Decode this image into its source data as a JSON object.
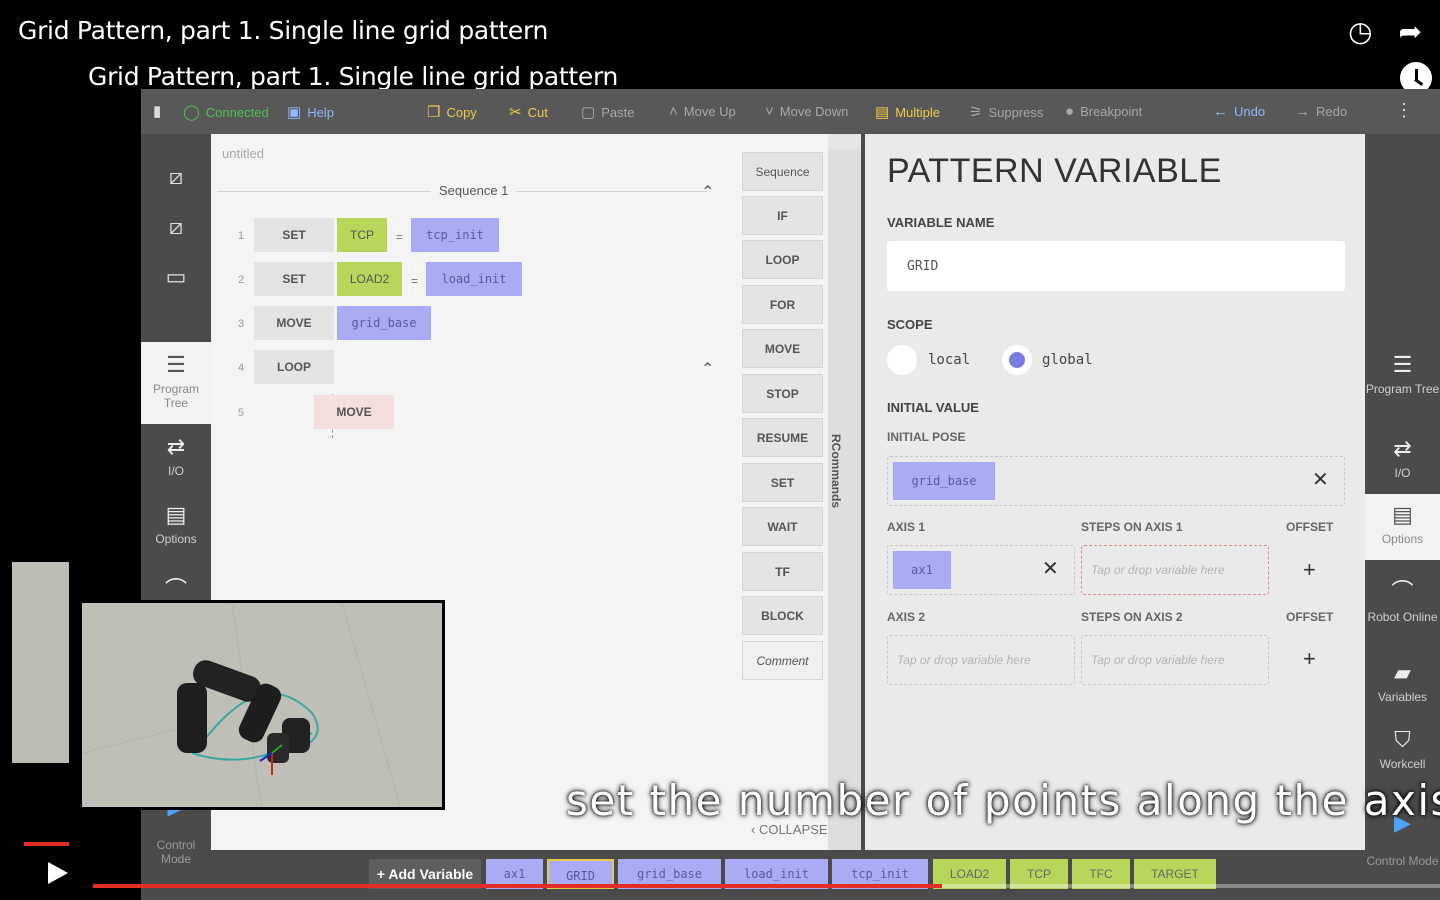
{
  "youtube": {
    "top_title": "Grid Pattern, part 1. Single line grid pattern",
    "video_title": "Grid Pattern, part 1. Single line grid pattern",
    "watch_later_icon": "clock-icon",
    "share_icon": "share-arrow-icon",
    "caption": "set the number of points along the axis",
    "progress_fraction": 0.63
  },
  "toolbar": {
    "connected": "Connected",
    "help": "Help",
    "copy": "Copy",
    "cut": "Cut",
    "paste": "Paste",
    "move_up": "Move Up",
    "move_down": "Move Down",
    "multiple": "Multiple",
    "suppress": "Suppress",
    "breakpoint": "Breakpoint",
    "undo": "Undo",
    "redo": "Redo"
  },
  "left_rail": {
    "program_tree": "Program Tree",
    "io": "I/O",
    "options": "Options",
    "control_mode": "Control Mode"
  },
  "tree": {
    "file_name": "untitled",
    "sequence_label": "Sequence 1",
    "rows": [
      {
        "num": "1",
        "cmd": "SET",
        "a": "TCP",
        "eq": "=",
        "b": "tcp_init"
      },
      {
        "num": "2",
        "cmd": "SET",
        "a": "LOAD2",
        "eq": "=",
        "b": "load_init"
      },
      {
        "num": "3",
        "cmd": "MOVE",
        "b": "grid_base"
      },
      {
        "num": "4",
        "cmd": "LOOP"
      },
      {
        "num": "5",
        "cmd": "MOVE"
      }
    ]
  },
  "commands": [
    "Sequence",
    "IF",
    "LOOP",
    "FOR",
    "MOVE",
    "STOP",
    "RESUME",
    "SET",
    "WAIT",
    "TF",
    "BLOCK",
    "Comment"
  ],
  "rcommands_label": "RCommands",
  "collapse_label": "COLLAPSE",
  "pattern_panel": {
    "title": "PATTERN VARIABLE",
    "variable_name_label": "VARIABLE NAME",
    "variable_name_value": "GRID",
    "scope_label": "SCOPE",
    "scope_local": "local",
    "scope_global": "global",
    "scope_selected": "global",
    "initial_value_label": "INITIAL VALUE",
    "initial_pose_label": "INITIAL POSE",
    "initial_pose_value": "grid_base",
    "axis1_label": "AXIS 1",
    "axis1_value": "ax1",
    "steps_axis1_label": "STEPS ON AXIS 1",
    "steps_axis1_placeholder": "Tap or drop variable here",
    "offset1_label": "OFFSET",
    "axis2_label": "AXIS 2",
    "axis2_placeholder": "Tap or drop variable here",
    "steps_axis2_label": "STEPS ON AXIS 2",
    "steps_axis2_placeholder": "Tap or drop variable here",
    "offset2_label": "OFFSET",
    "clear_symbol": "✕",
    "add_symbol": "+"
  },
  "right_rail": {
    "program_tree": "Program Tree",
    "io": "I/O",
    "options": "Options",
    "robot_online": "Robot Online",
    "variables": "Variables",
    "workcell": "Workcell",
    "control_mode": "Control Mode"
  },
  "varbar": {
    "add_variable": "+ Add Variable",
    "variables": [
      "ax1",
      "GRID",
      "grid_base",
      "load_init",
      "tcp_init",
      "LOAD2",
      "TCP",
      "TFC",
      "TARGET"
    ],
    "selected": "GRID"
  },
  "colors": {
    "pose_purple": "#a9abf5",
    "load_lime": "#b8d65a",
    "connected_green": "#4fc34f",
    "accent_blue": "#8fb6ff",
    "progress_red": "#e52d27"
  }
}
